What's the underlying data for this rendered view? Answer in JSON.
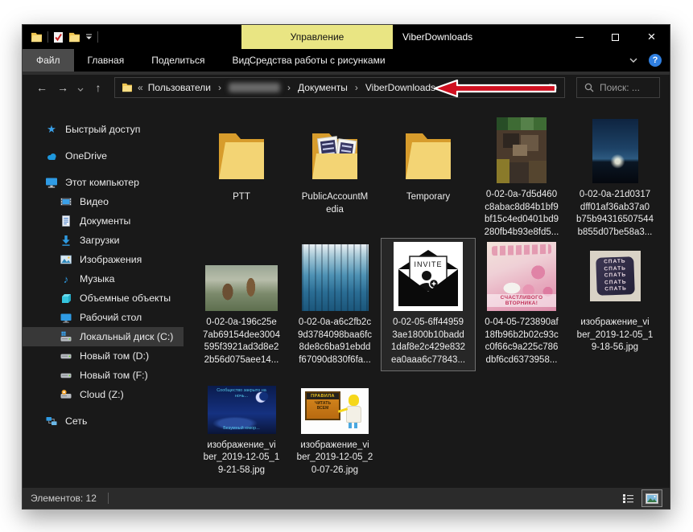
{
  "window": {
    "title": "ViberDownloads",
    "contextual_tab_header": "Управление",
    "controls": {
      "close": "×"
    },
    "help_label": "?"
  },
  "ribbon": {
    "tabs": [
      {
        "label": "Файл",
        "active": true
      },
      {
        "label": "Главная"
      },
      {
        "label": "Поделиться"
      },
      {
        "label": "Вид"
      },
      {
        "label": "Средства работы с рисунками",
        "contextual": true
      }
    ]
  },
  "address_bar": {
    "back": "←",
    "forward": "→",
    "up": "↑",
    "overflow_chevrons": "«",
    "separator": "›",
    "crumb_users": "Пользователи",
    "crumb_documents": "Документы",
    "crumb_current": "ViberDownloads",
    "username_redacted": true,
    "refresh": "↻",
    "search_placeholder": "Поиск: ..."
  },
  "sidebar": {
    "items": [
      {
        "label": "Быстрый доступ",
        "icon": "star"
      },
      {
        "label": "OneDrive",
        "icon": "cloud"
      },
      {
        "label": "Этот компьютер",
        "icon": "computer"
      },
      {
        "label": "Видео",
        "icon": "video"
      },
      {
        "label": "Документы",
        "icon": "documents"
      },
      {
        "label": "Загрузки",
        "icon": "downloads"
      },
      {
        "label": "Изображения",
        "icon": "pictures"
      },
      {
        "label": "Музыка",
        "icon": "music"
      },
      {
        "label": "Объемные объекты",
        "icon": "3d-objects"
      },
      {
        "label": "Рабочий стол",
        "icon": "desktop"
      },
      {
        "label": "Локальный диск (C:)",
        "icon": "drive-windows",
        "selected": true
      },
      {
        "label": "Новый том (D:)",
        "icon": "drive"
      },
      {
        "label": "Новый том (F:)",
        "icon": "drive"
      },
      {
        "label": "Cloud (Z:)",
        "icon": "drive-cloud"
      },
      {
        "label": "Сеть",
        "icon": "network"
      }
    ]
  },
  "content": {
    "items": [
      {
        "label": "PTT",
        "type": "folder"
      },
      {
        "label": "PublicAccountM\nedia",
        "type": "folder"
      },
      {
        "label": "Temporary",
        "type": "folder"
      },
      {
        "label": "0-02-0a-7d5d460\nc8abac8d84b1bf9\nbf15c4ed0401bd9\n280fb4b93e8fd5...",
        "type": "image"
      },
      {
        "label": "0-02-0a-21d0317\ndff01af36ab37a0\nb75b94316507544\nb855d07be58a3...",
        "type": "image"
      },
      {
        "label": "0-02-0a-196c25e\n7ab69154dee3004\n595f3921ad3d8e2\n2b56d075aee14...",
        "type": "image"
      },
      {
        "label": "0-02-0a-a6c2fb2c\n9d3784098baa6fc\n8de8c6ba91ebdd\nf67090d830f6fa...",
        "type": "image"
      },
      {
        "label": "0-02-05-6ff44959\n3ae1800b10badd\n1daf8e2c429e832\nea0aaa6c77843...",
        "type": "image",
        "selected": true,
        "thumb_text": "INVITE"
      },
      {
        "label": "0-04-05-723890af\n18fb96b2b02c93c\nc0f66c9a225c786\ndbf6cd6373958...",
        "type": "image",
        "thumb_text": "СЧАСТЛИВОГО ВТОРНИКА!"
      },
      {
        "label": "изображение_vi\nber_2019-12-05_1\n9-18-56.jpg",
        "type": "image",
        "thumb_text": "СПАТЬ\nСПАТЬ\nСПАТЬ\nСПАТЬ\nСПАТЬ"
      },
      {
        "label": "изображение_vi\nber_2019-12-05_1\n9-21-58.jpg",
        "type": "image",
        "thumb_text_top": "Сообщество закрыто на\nночь...",
        "thumb_text_bottom": "Безумный юмор..."
      },
      {
        "label": "изображение_vi\nber_2019-12-05_2\n0-07-26.jpg",
        "type": "image",
        "thumb_sign_title": "ПРАВИЛА",
        "thumb_sign_body": "ЧИТАТЬ\nВСЕМ"
      }
    ]
  },
  "status_bar": {
    "items_count": "Элементов: 12"
  }
}
